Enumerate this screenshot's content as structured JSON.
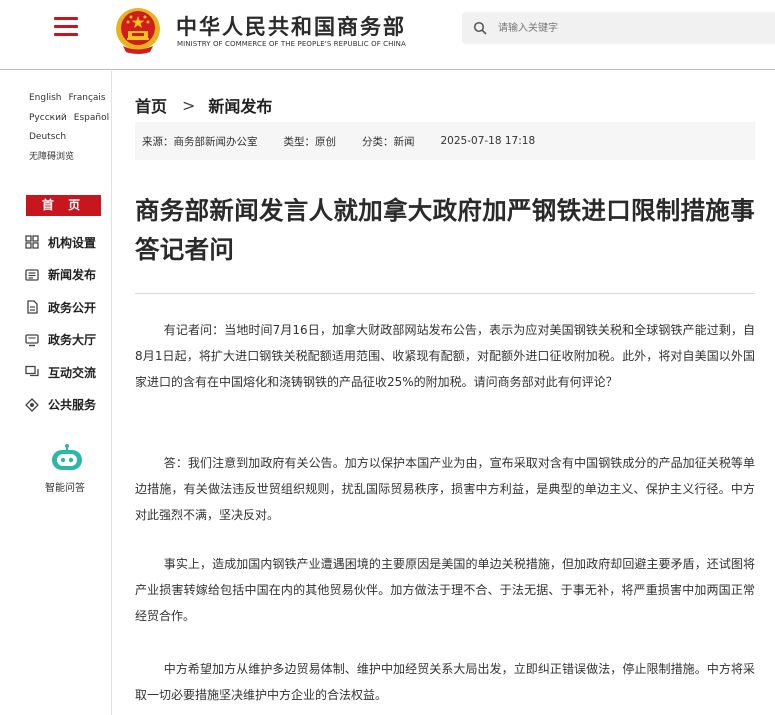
{
  "header": {
    "site_title_cn": "中华人民共和国商务部",
    "site_title_en": "MINISTRY OF COMMERCE OF THE PEOPLE'S REPUBLIC OF CHINA",
    "search_placeholder": "请输入关键字",
    "accent_color": "#c8161e"
  },
  "sidebar": {
    "languages": [
      [
        "English",
        "Français"
      ],
      [
        "Русский",
        "Español"
      ],
      [
        "Deutsch"
      ],
      [
        "无障碍浏览"
      ]
    ],
    "home_label": "首 页",
    "nav": [
      {
        "label": "机构设置",
        "icon": "grid-icon"
      },
      {
        "label": "新闻发布",
        "icon": "news-icon"
      },
      {
        "label": "政务公开",
        "icon": "document-icon"
      },
      {
        "label": "政务大厅",
        "icon": "monitor-icon"
      },
      {
        "label": "互动交流",
        "icon": "chat-icon"
      },
      {
        "label": "公共服务",
        "icon": "service-icon"
      }
    ],
    "assistant_label": "智能问答"
  },
  "breadcrumb": {
    "home": "首页",
    "separator": ">",
    "current": "新闻发布"
  },
  "meta": {
    "source": "来源：商务部新闻办公室",
    "type": "类型：原创",
    "category": "分类：新闻",
    "datetime": "2025-07-18 17:18"
  },
  "article": {
    "title": "商务部新闻发言人就加拿大政府加严钢铁进口限制措施事答记者问",
    "paragraphs": [
      "有记者问：当地时间7月16日，加拿大财政部网站发布公告，表示为应对美国钢铁关税和全球钢铁产能过剩，自8月1日起，将扩大进口钢铁关税配额适用范围、收紧现有配额，对配额外进口征收附加税。此外，将对自美国以外国家进口的含有在中国熔化和浇铸钢铁的产品征收25%的附加税。请问商务部对此有何评论？",
      "答：我们注意到加政府有关公告。加方以保护本国产业为由，宣布采取对含有中国钢铁成分的产品加征关税等单边措施，有关做法违反世贸组织规则，扰乱国际贸易秩序，损害中方利益，是典型的单边主义、保护主义行径。中方对此强烈不满，坚决反对。",
      "事实上，造成加国内钢铁产业遭遇困境的主要原因是美国的单边关税措施，但加政府却回避主要矛盾，还试图将产业损害转嫁给包括中国在内的其他贸易伙伴。加方做法于理不合、于法无据、于事无补，将严重损害中加两国正常经贸合作。",
      "中方希望加方从维护多边贸易体制、维护中加经贸关系大局出发，立即纠正错误做法，停止限制措施。中方将采取一切必要措施坚决维护中方企业的合法权益。"
    ]
  }
}
